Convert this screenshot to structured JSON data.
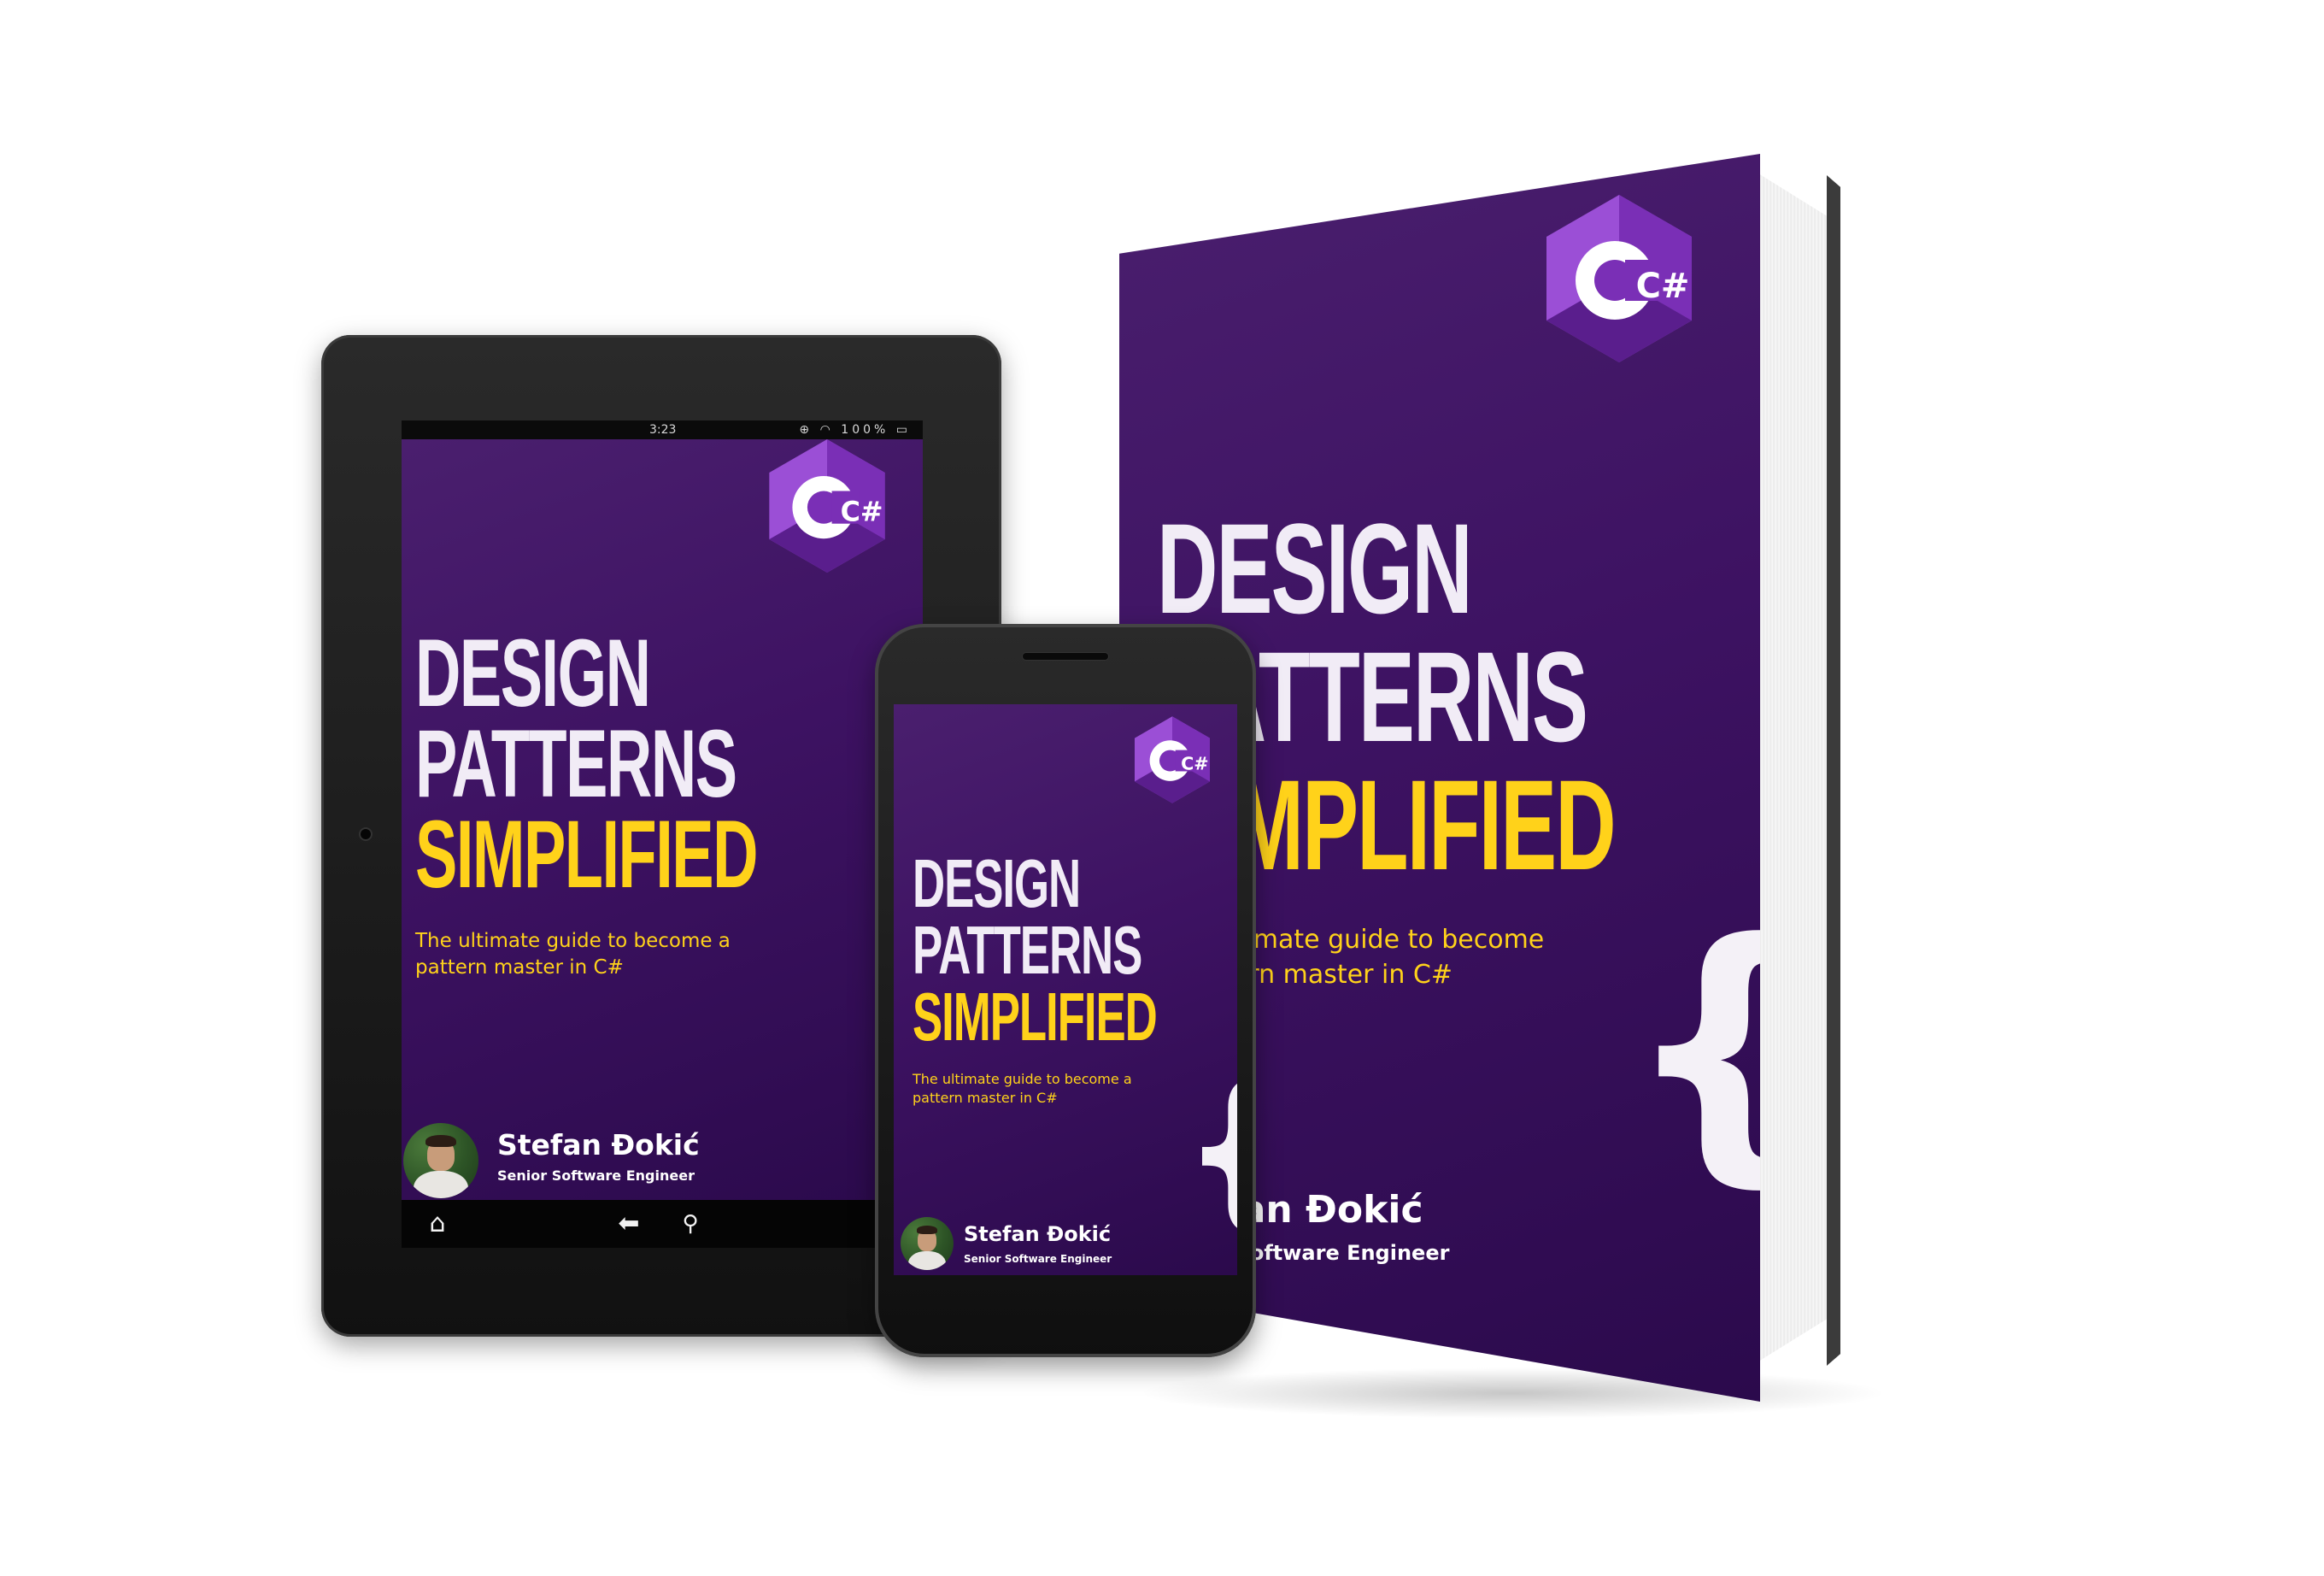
{
  "book": {
    "title_line1": "DESIGN",
    "title_line2": "PATTERNS",
    "title_line3": "SIMPLIFIED",
    "subtitle": "The ultimate guide to become a pattern master in C#",
    "author": "Stefan Đokić",
    "author_role": "Senior Software Engineer",
    "logo_text": "C#",
    "brace": "{"
  },
  "tablet": {
    "status_time": "3:23",
    "status_battery": "100%",
    "status_icons": [
      "add-circle-icon",
      "wifi-icon",
      "battery-icon"
    ],
    "nav_icons": [
      "home-icon",
      "back-arrow-icon",
      "search-icon"
    ]
  },
  "colors": {
    "cover_purple": "#3d1262",
    "title_white": "#f1ecf6",
    "title_yellow": "#ffd21a"
  }
}
